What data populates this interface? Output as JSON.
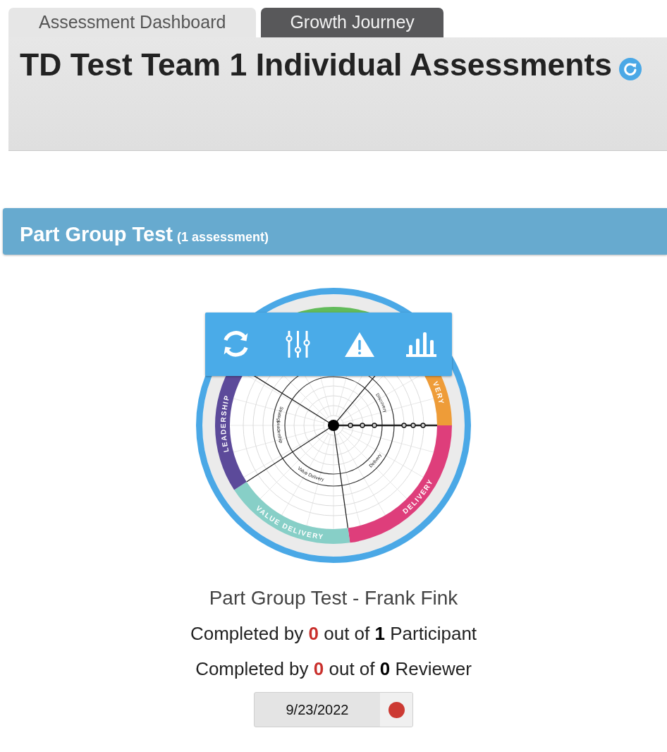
{
  "tabs": [
    {
      "label": "Assessment Dashboard",
      "selected": true
    },
    {
      "label": "Growth Journey",
      "selected": false
    }
  ],
  "header": {
    "title": "TD Test Team 1 Individual Assessments"
  },
  "group": {
    "title": "Part Group Test",
    "count": "(1 assessment)"
  },
  "assessment": {
    "wheel": {
      "bands": [
        {
          "color": "#62bb5a"
        },
        {
          "label": "VERY",
          "color": "#ee9c38"
        },
        {
          "label": "DELIVERY",
          "color": "#de3e7b"
        },
        {
          "label": "VALUE DELIVERY",
          "color": "#87cfc7"
        },
        {
          "label": "LEADERSHIP",
          "color": "#5c4a9a"
        }
      ],
      "inner_labels": [
        "Strategy",
        "Discovery",
        "Delivery",
        "Value Delivery",
        "Leadership"
      ]
    },
    "name": "Part Group Test - Frank Fink",
    "completion": [
      {
        "prefix": "Completed by",
        "done": "0",
        "middle": "out of",
        "total": "1",
        "role": "Participant"
      },
      {
        "prefix": "Completed by",
        "done": "0",
        "middle": "out of",
        "total": "0",
        "role": "Reviewer"
      }
    ],
    "date_badge": {
      "date": "9/23/2022",
      "color": "#cc3a33"
    }
  }
}
